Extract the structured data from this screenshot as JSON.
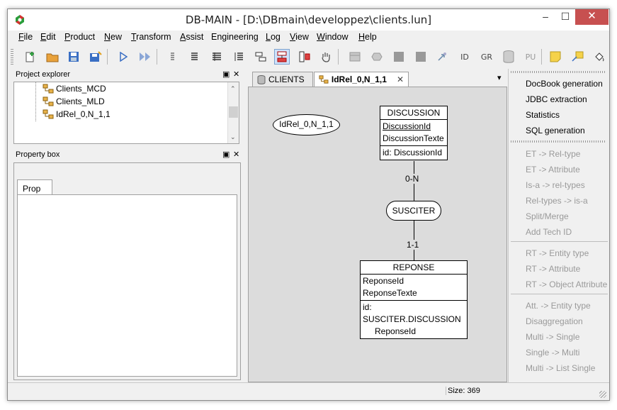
{
  "window": {
    "title": "DB-MAIN  - [D:\\DBmain\\developpez\\clients.lun]",
    "minimize_glyph": "–",
    "maximize_glyph": "☐",
    "close_glyph": "✕"
  },
  "menubar": {
    "items": [
      {
        "label": "File",
        "underline": "F"
      },
      {
        "label": "Edit",
        "underline": "E"
      },
      {
        "label": "Product",
        "underline": "P"
      },
      {
        "label": "New",
        "underline": "N"
      },
      {
        "label": "Transform",
        "underline": "T"
      },
      {
        "label": "Assist",
        "underline": "A"
      },
      {
        "label": "Engineering",
        "underline": "g"
      },
      {
        "label": "Log",
        "underline": "L"
      },
      {
        "label": "View",
        "underline": "V"
      },
      {
        "label": "Window",
        "underline": "W"
      },
      {
        "label": "Help",
        "underline": "H"
      }
    ]
  },
  "toolbar": {
    "id_label": "ID",
    "gr_label": "GR",
    "pu_label": "PU"
  },
  "project_explorer": {
    "title": "Project explorer",
    "items": [
      "Clients_MCD",
      "Clients_MLD",
      "IdRel_0,N_1,1"
    ]
  },
  "property_box": {
    "title": "Property box",
    "tab": "Prop"
  },
  "panel_controls": {
    "dock": "▣",
    "close": "✕"
  },
  "editor": {
    "tabs": [
      {
        "label": "CLIENTS",
        "active": false
      },
      {
        "label": "IdRel_0,N_1,1",
        "active": true,
        "close": "✕"
      }
    ],
    "menu_glyph": "▾"
  },
  "schema": {
    "schema_name": "IdRel_0,N_1,1",
    "entities": [
      {
        "name": "DISCUSSION",
        "attributes": [
          "DiscussionId",
          "DiscussionTexte"
        ],
        "primary_attribute": "DiscussionId",
        "identifiers": [
          "id: DiscussionId"
        ]
      },
      {
        "name": "REPONSE",
        "attributes": [
          "ReponseId",
          "ReponseTexte"
        ],
        "identifiers": [
          "id: SUSCITER.DISCUSSION",
          "ReponseId"
        ]
      }
    ],
    "relationship": "SUSCITER",
    "cardinality_top": "0-N",
    "cardinality_bottom": "1-1"
  },
  "right_panel": {
    "top_items": [
      "DocBook generation",
      "JDBC extraction",
      "Statistics",
      "SQL generation"
    ],
    "group1": [
      "ET -> Rel-type",
      "ET -> Attribute",
      "Is-a -> rel-types",
      "Rel-types -> is-a",
      "Split/Merge",
      "Add Tech ID"
    ],
    "group2": [
      "RT -> Entity type",
      "RT -> Attribute",
      "RT -> Object Attribute"
    ],
    "group3": [
      "Att. -> Entity type",
      "Disaggregation",
      "Multi -> Single",
      "Single -> Multi",
      "Multi -> List Single"
    ]
  },
  "statusbar": {
    "size": "Size: 369"
  }
}
